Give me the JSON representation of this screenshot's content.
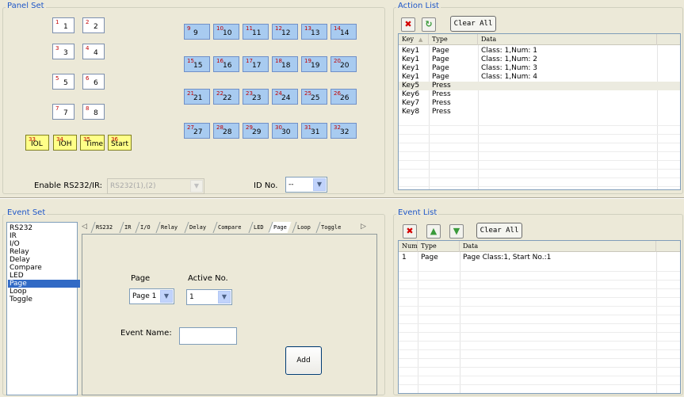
{
  "panel_set": {
    "title": "Panel Set",
    "white_keys": [
      {
        "num": "1",
        "label": "1"
      },
      {
        "num": "2",
        "label": "2"
      },
      {
        "num": "3",
        "label": "3"
      },
      {
        "num": "4",
        "label": "4"
      },
      {
        "num": "5",
        "label": "5"
      },
      {
        "num": "6",
        "label": "6"
      },
      {
        "num": "7",
        "label": "7"
      },
      {
        "num": "8",
        "label": "8"
      }
    ],
    "blue_keys": [
      {
        "num": "9",
        "label": "9"
      },
      {
        "num": "10",
        "label": "10"
      },
      {
        "num": "11",
        "label": "11"
      },
      {
        "num": "12",
        "label": "12"
      },
      {
        "num": "13",
        "label": "13"
      },
      {
        "num": "14",
        "label": "14"
      },
      {
        "num": "15",
        "label": "15"
      },
      {
        "num": "16",
        "label": "16"
      },
      {
        "num": "17",
        "label": "17"
      },
      {
        "num": "18",
        "label": "18"
      },
      {
        "num": "19",
        "label": "19"
      },
      {
        "num": "20",
        "label": "20"
      },
      {
        "num": "21",
        "label": "21"
      },
      {
        "num": "22",
        "label": "22"
      },
      {
        "num": "23",
        "label": "23"
      },
      {
        "num": "24",
        "label": "24"
      },
      {
        "num": "25",
        "label": "25"
      },
      {
        "num": "26",
        "label": "26"
      },
      {
        "num": "27",
        "label": "27"
      },
      {
        "num": "28",
        "label": "28"
      },
      {
        "num": "29",
        "label": "29"
      },
      {
        "num": "30",
        "label": "30"
      },
      {
        "num": "31",
        "label": "31"
      },
      {
        "num": "32",
        "label": "32"
      }
    ],
    "yellow_keys": [
      {
        "num": "33",
        "label": "IOL"
      },
      {
        "num": "34",
        "label": "IOH"
      },
      {
        "num": "35",
        "label": "Time"
      },
      {
        "num": "36",
        "label": "Start"
      }
    ],
    "enable_label": "Enable RS232/IR:",
    "enable_value": "RS232(1),(2)",
    "id_label": "ID No.",
    "id_value": "--",
    "colors": {
      "blue_key": "#a8cbf0",
      "yellow_key": "#ffff88",
      "key_number": "#c00000"
    }
  },
  "action_list": {
    "title": "Action List",
    "delete_icon": "red-x-icon",
    "refresh_icon": "green-refresh-icon",
    "clear_label": "Clear All",
    "columns": [
      "Key",
      "Type",
      "Data"
    ],
    "sort_icon": "sort-up-icon",
    "rows": [
      {
        "key": "Key1",
        "type": "Page",
        "data": "Class: 1,Num: 1"
      },
      {
        "key": "Key1",
        "type": "Page",
        "data": "Class: 1,Num: 2"
      },
      {
        "key": "Key1",
        "type": "Page",
        "data": "Class: 1,Num: 3"
      },
      {
        "key": "Key1",
        "type": "Page",
        "data": "Class: 1,Num: 4"
      },
      {
        "key": "Key5",
        "type": "Press",
        "data": ""
      },
      {
        "key": "Key6",
        "type": "Press",
        "data": ""
      },
      {
        "key": "Key7",
        "type": "Press",
        "data": ""
      },
      {
        "key": "Key8",
        "type": "Press",
        "data": ""
      }
    ]
  },
  "event_set": {
    "title": "Event Set",
    "list_items": [
      "RS232",
      "IR",
      "I/O",
      "Relay",
      "Delay",
      "Compare",
      "LED",
      "Page",
      "Loop",
      "Toggle"
    ],
    "selected_item": "Page",
    "tabs": [
      "RS232",
      "IR",
      "I/O",
      "Relay",
      "Delay",
      "Compare",
      "LED",
      "Page",
      "Loop",
      "Toggle"
    ],
    "active_tab": "Page",
    "page_label": "Page",
    "page_value": "Page 1",
    "active_no_label": "Active No.",
    "active_no_value": "1",
    "event_name_label": "Event Name:",
    "event_name_value": "",
    "add_label": "Add"
  },
  "event_list": {
    "title": "Event List",
    "delete_icon": "red-x-icon",
    "up_icon": "green-up-arrow-icon",
    "down_icon": "green-down-arrow-icon",
    "clear_label": "Clear All",
    "columns": [
      "Num",
      "Type",
      "Data"
    ],
    "rows": [
      {
        "num": "1",
        "type": "Page",
        "data": "Page Class:1, Start No.:1"
      }
    ]
  }
}
